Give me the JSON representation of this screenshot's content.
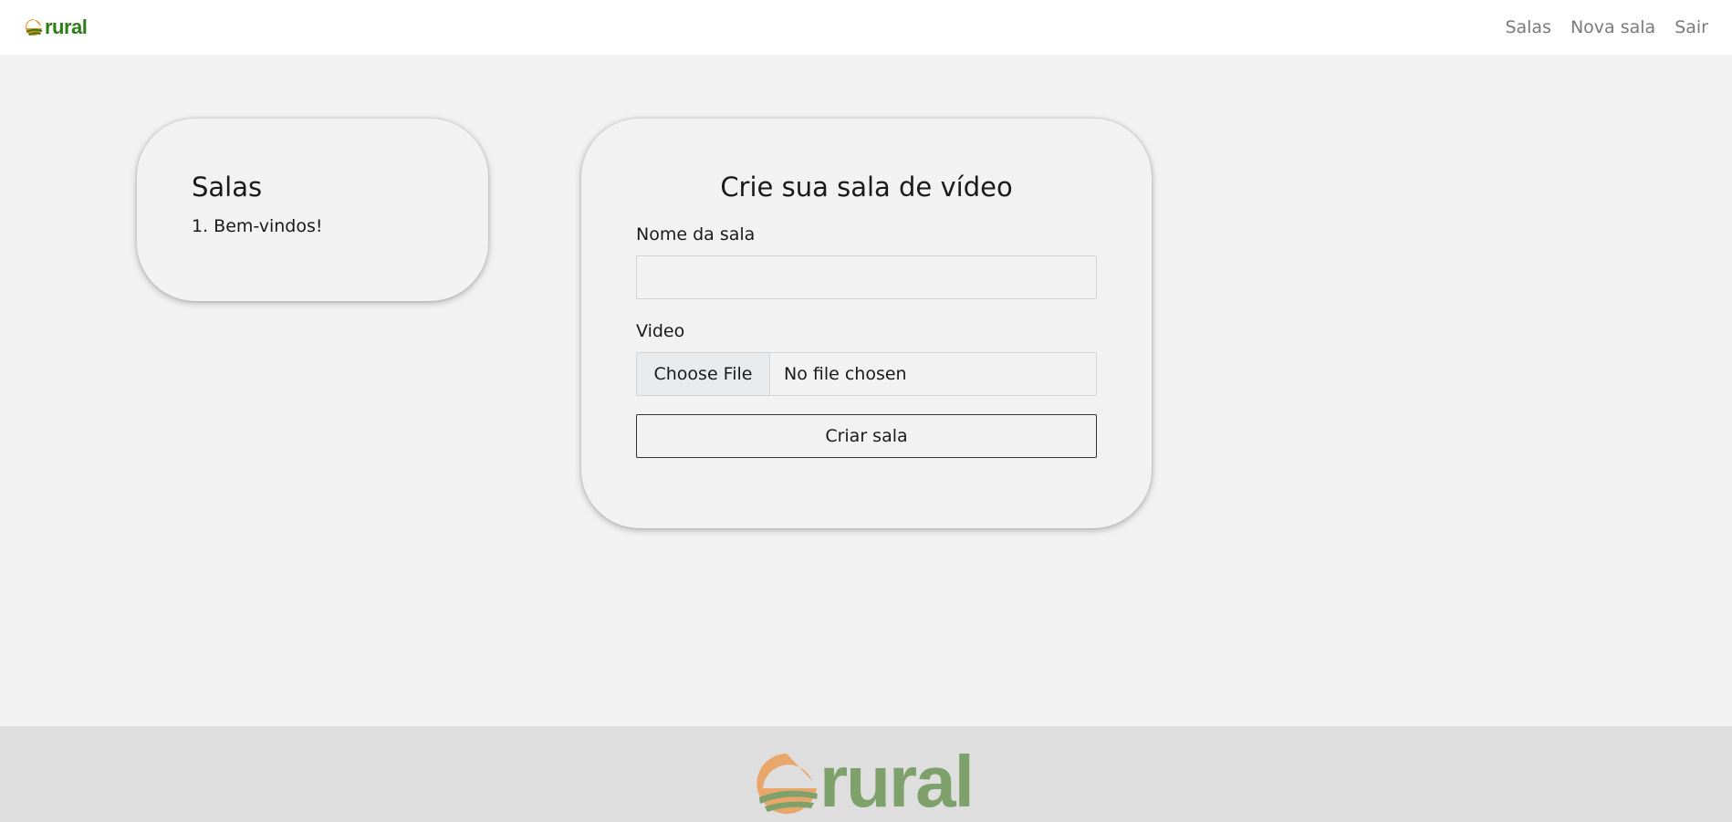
{
  "navbar": {
    "brand": "rural",
    "links": [
      "Salas",
      "Nova sala",
      "Sair"
    ]
  },
  "salas": {
    "title": "Salas",
    "items": [
      "1. Bem-vindos!"
    ]
  },
  "form": {
    "title": "Crie sua sala de vídeo",
    "name_label": "Nome da sala",
    "name_value": "",
    "name_placeholder": "",
    "video_label": "Video",
    "file_button": "Choose File",
    "file_status": "No file chosen",
    "submit": "Criar sala"
  },
  "footer": {
    "brand": "rural"
  },
  "colors": {
    "brand_green": "#2e7d1a",
    "brand_orange": "#f08a1e",
    "footer_green": "#7ea06a",
    "footer_orange": "#e8a66a"
  }
}
